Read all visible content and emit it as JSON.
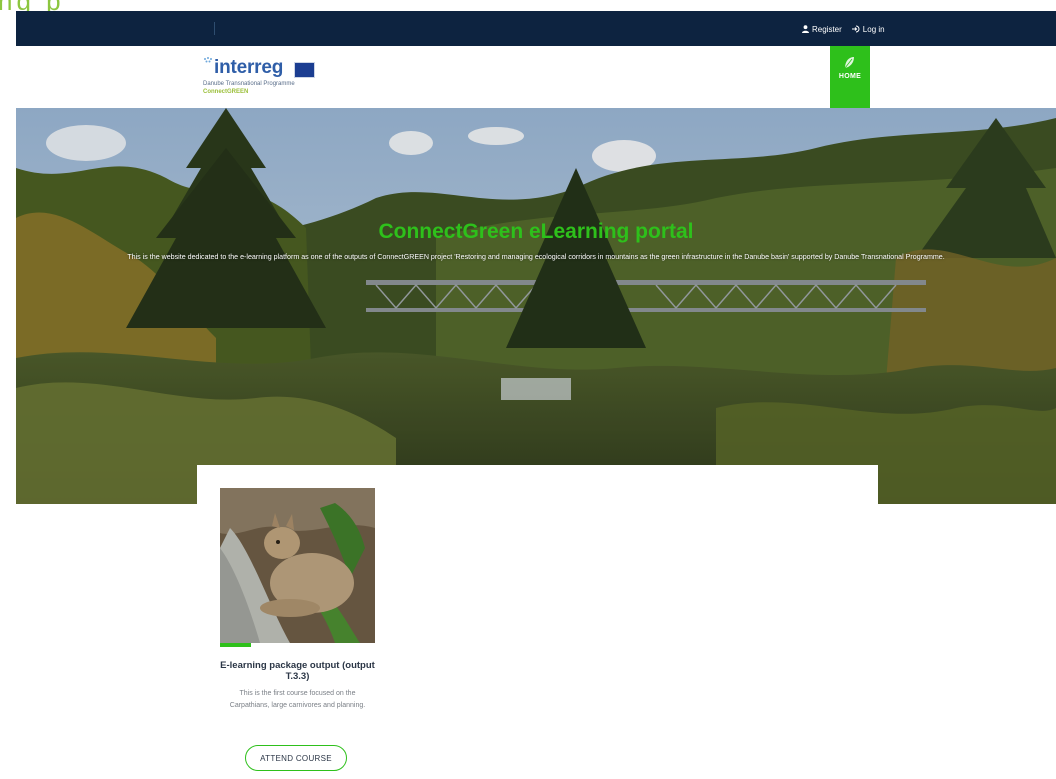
{
  "frame_fragment": "ng p",
  "topbar": {
    "register_label": "Register",
    "login_label": "Log in"
  },
  "logo": {
    "brand": "interreg",
    "programme": "Danube Transnational Programme",
    "project": "ConnectGREEN"
  },
  "nav": {
    "home_label": "HOME"
  },
  "hero": {
    "title": "ConnectGreen eLearning portal",
    "description": "This is the website dedicated to the e-learning platform as one of the outputs of ConnectGREEN project 'Restoring and managing ecological corridors in mountains as the green infrastructure in the Danube basin' supported by Danube Transnational Programme."
  },
  "course": {
    "title": "E-learning package output (output T.3.3)",
    "description": "This is the first course focused on the Carpathians, large carnivores and planning.",
    "button_label": "ATTEND COURSE"
  },
  "colors": {
    "topbar": "#0d2340",
    "accent_green": "#2ec01b",
    "brand_blue": "#2f5ea8"
  },
  "icons": {
    "register": "user-icon",
    "login": "sign-in-icon",
    "home": "leaf-icon"
  }
}
